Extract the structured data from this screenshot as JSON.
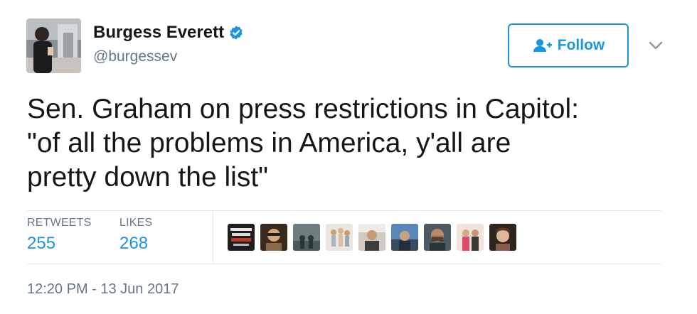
{
  "author": {
    "name": "Burgess Everett",
    "handle": "@burgessev",
    "verified": true,
    "avatar_icon": "profile-photo"
  },
  "header": {
    "follow_label": "Follow",
    "follow_icon": "add-person-icon",
    "more_icon": "chevron-down-icon"
  },
  "tweet": {
    "lines": [
      "Sen. Graham on press restrictions in Capitol:",
      "\"of all the problems in America, y'all are",
      "pretty down the list\""
    ]
  },
  "stats": {
    "retweets_label": "RETWEETS",
    "retweets_count": "255",
    "likes_label": "LIKES",
    "likes_count": "268"
  },
  "likers": {
    "count_shown": 9
  },
  "timestamp": "12:20 PM - 13 Jun 2017",
  "colors": {
    "accent": "#1b95e0",
    "secondary_text": "#657786",
    "primary_text": "#14171a",
    "divider": "#e1e8ed"
  }
}
